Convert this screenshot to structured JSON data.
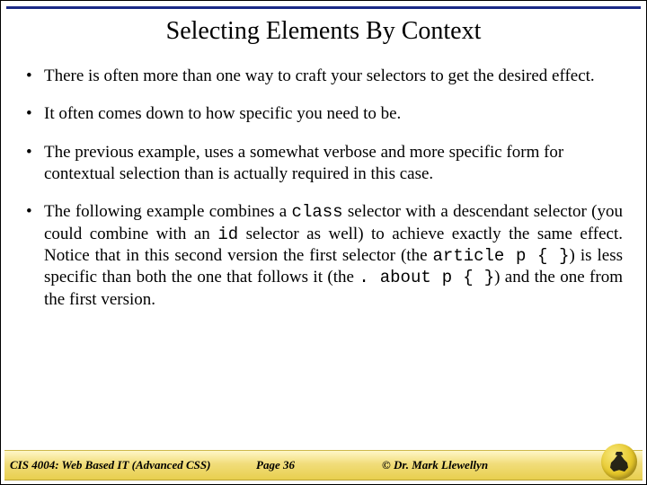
{
  "title": "Selecting Elements By Context",
  "bullets": {
    "b1": "There is often more than one way to craft your selectors to get the desired effect.",
    "b2": "It often comes down to how specific you need to be.",
    "b3": "The previous example, uses a somewhat verbose and more specific form for contextual selection than is actually required in this case.",
    "b4_a": "The following example combines a ",
    "b4_code1": "class",
    "b4_b": " selector with a descendant selector (you could combine with an ",
    "b4_code2": "id",
    "b4_c": " selector as well) to achieve exactly the same effect.  Notice that in this second version the first selector (the ",
    "b4_code3": "article p { }",
    "b4_d": ") is less specific than both the one that follows it (the ",
    "b4_code4": ". about p { }",
    "b4_e": ") and the one from the first version."
  },
  "footer": {
    "left": "CIS 4004: Web Based IT (Advanced CSS)",
    "center": "Page 36",
    "right": "© Dr. Mark Llewellyn"
  }
}
